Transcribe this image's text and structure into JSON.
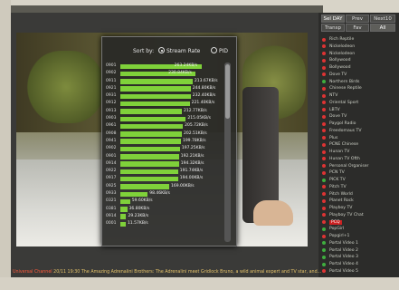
{
  "overlay": {
    "sort_label": "Sort by:",
    "option_stream": "Stream Rate",
    "option_pid": "PID",
    "rows": [
      {
        "pid": "0901",
        "rate": "263.24KB/s",
        "frac": 0.83
      },
      {
        "pid": "0902",
        "rate": "230.84KB/s",
        "frac": 0.77
      },
      {
        "pid": "0911",
        "rate": "213.67KB/s",
        "frac": 0.74
      },
      {
        "pid": "0921",
        "rate": "244.80KB/s",
        "frac": 0.72
      },
      {
        "pid": "0931",
        "rate": "232.40KB/s",
        "frac": 0.72
      },
      {
        "pid": "0912",
        "rate": "221.40KB/s",
        "frac": 0.71
      },
      {
        "pid": "0913",
        "rate": "212.77KB/s",
        "frac": 0.63
      },
      {
        "pid": "0903",
        "rate": "215.05KB/s",
        "frac": 0.67
      },
      {
        "pid": "0961",
        "rate": "205.72KB/s",
        "frac": 0.64
      },
      {
        "pid": "0908",
        "rate": "202.51KB/s",
        "frac": 0.63
      },
      {
        "pid": "0941",
        "rate": "199.78KB/s",
        "frac": 0.62
      },
      {
        "pid": "0902",
        "rate": "197.25KB/s",
        "frac": 0.61
      },
      {
        "pid": "0901",
        "rate": "192.21KB/s",
        "frac": 0.6
      },
      {
        "pid": "0914",
        "rate": "194.32KB/s",
        "frac": 0.6
      },
      {
        "pid": "0922",
        "rate": "191.74KB/s",
        "frac": 0.59
      },
      {
        "pid": "0917",
        "rate": "194.00KB/s",
        "frac": 0.59
      },
      {
        "pid": "0925",
        "rate": "169.00KB/s",
        "frac": 0.5
      },
      {
        "pid": "0933",
        "rate": "98.46KB/s",
        "frac": 0.28
      },
      {
        "pid": "0321",
        "rate": "59.60KB/s",
        "frac": 0.1
      },
      {
        "pid": "0381",
        "rate": "36.80KB/s",
        "frac": 0.07
      },
      {
        "pid": "0914",
        "rate": "29.23KB/s",
        "frac": 0.06
      },
      {
        "pid": "0001",
        "rate": "11.57KB/s",
        "frac": 0.04
      }
    ]
  },
  "side": {
    "buttons": [
      {
        "label": "Sel DAY",
        "selected": true
      },
      {
        "label": "Prev",
        "selected": false
      },
      {
        "label": "Next10",
        "selected": false
      },
      {
        "label": "Transp",
        "selected": false
      },
      {
        "label": "Fav",
        "selected": false
      },
      {
        "label": "All",
        "selected": true
      }
    ],
    "channels": [
      {
        "name": "Rich Reptile",
        "color": "red"
      },
      {
        "name": "Nickelodeon",
        "color": "red"
      },
      {
        "name": "Nickelodeon",
        "color": "red"
      },
      {
        "name": "Bollywood",
        "color": "red"
      },
      {
        "name": "Bollywood",
        "color": "red"
      },
      {
        "name": "Dove TV",
        "color": "red"
      },
      {
        "name": "Northern Birds",
        "color": "green"
      },
      {
        "name": "Chinese Reptile",
        "color": "red"
      },
      {
        "name": "NTV",
        "color": "red"
      },
      {
        "name": "Oriental Sport",
        "color": "red"
      },
      {
        "name": "LBTV",
        "color": "red"
      },
      {
        "name": "Dove TV",
        "color": "red"
      },
      {
        "name": "Paygol Radio",
        "color": "red"
      },
      {
        "name": "Freedomaus TV",
        "color": "red"
      },
      {
        "name": "Plus",
        "color": "red"
      },
      {
        "name": "PCNE Chinese",
        "color": "red"
      },
      {
        "name": "Hunan TV",
        "color": "red"
      },
      {
        "name": "Hunan TV Ofth",
        "color": "red"
      },
      {
        "name": "Personal Organiser",
        "color": "red"
      },
      {
        "name": "PCN TV",
        "color": "red"
      },
      {
        "name": "PICK TV",
        "color": "green"
      },
      {
        "name": "Pitch TV",
        "color": "red"
      },
      {
        "name": "Pitch World",
        "color": "red"
      },
      {
        "name": "Planet Rock",
        "color": "red"
      },
      {
        "name": "Playboy TV",
        "color": "red"
      },
      {
        "name": "Playboy TV Chat",
        "color": "red"
      },
      {
        "name": "PCQ",
        "color": "red",
        "highlight": true
      },
      {
        "name": "PopGirl",
        "color": "green"
      },
      {
        "name": "Popgirl+1",
        "color": "red"
      },
      {
        "name": "Portal Video 1",
        "color": "green"
      },
      {
        "name": "Portal Video 2",
        "color": "green"
      },
      {
        "name": "Portal Video 3",
        "color": "green"
      },
      {
        "name": "Portal Video 4",
        "color": "green"
      },
      {
        "name": "Portal Video 5",
        "color": "red"
      }
    ]
  },
  "ticker": {
    "channel": "Universal Channel",
    "text": "20/11 19:30 The Amazing Adrenalini Brothers: The Adrenalini meet Gridlock Bruno, a wild animal expert and TV star, and..."
  }
}
